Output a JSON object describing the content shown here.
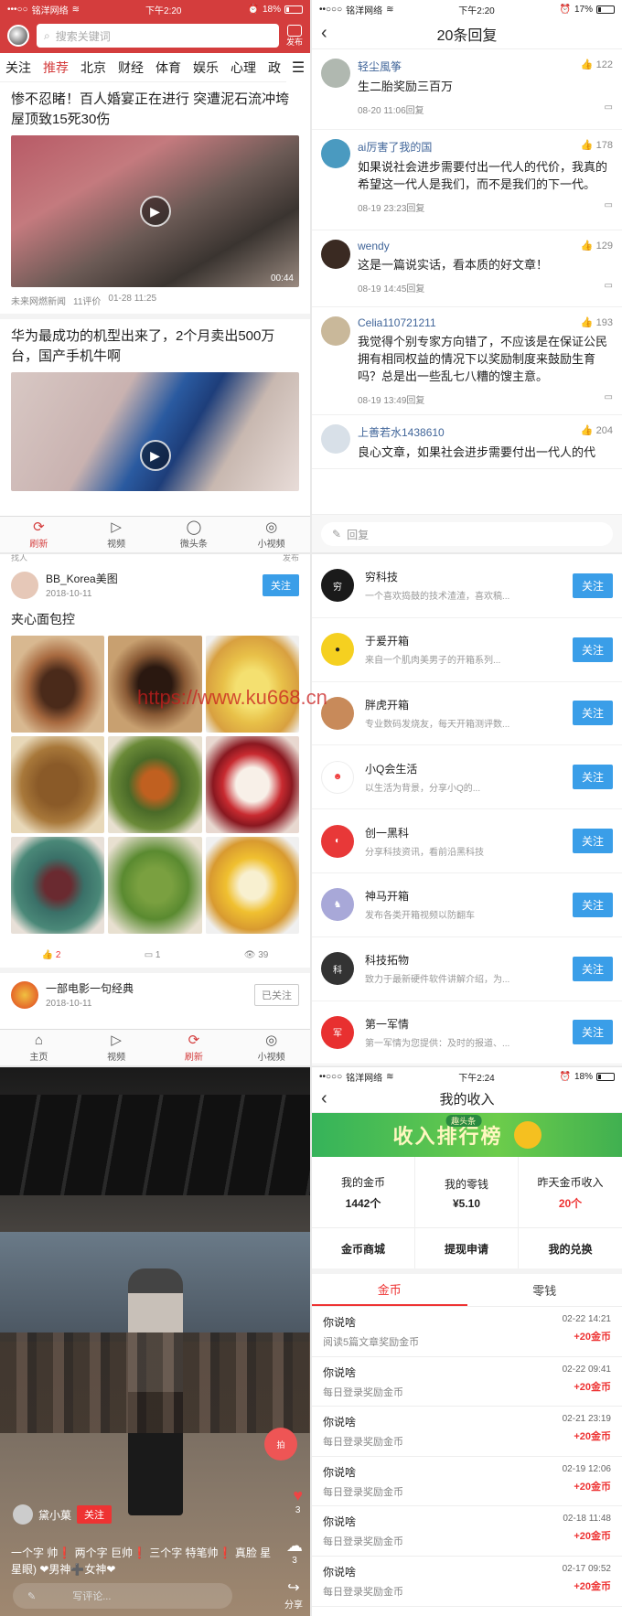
{
  "status1": {
    "carrier": "铭洋网络",
    "time": "下午2:20",
    "battery": "18%"
  },
  "status2": {
    "carrier": "铭洋网络",
    "time": "下午2:20",
    "battery": "17%"
  },
  "status6": {
    "carrier": "铭洋网络",
    "time": "下午2:24",
    "battery": "18%"
  },
  "feed": {
    "search_placeholder": "搜索关键词",
    "publish": "发布",
    "tabs": [
      "关注",
      "推荐",
      "北京",
      "财经",
      "体育",
      "娱乐",
      "心理",
      "政"
    ],
    "articles": [
      {
        "title": "惨不忍睹！百人婚宴正在进行 突遭泥石流冲垮屋顶致15死30伤",
        "duration": "00:44",
        "source": "未来网燃新闻",
        "comments": "11评价",
        "time": "01-28 11:25"
      },
      {
        "title": "华为最成功的机型出来了，2个月卖出500万台，国产手机牛啊"
      }
    ],
    "nav": [
      "刷新",
      "视频",
      "微头条",
      "小视频"
    ]
  },
  "replies": {
    "title": "20条回复",
    "items": [
      {
        "name": "轻尘風筝",
        "likes": "122",
        "text": "生二胎奖励三百万",
        "time": "08-20 11:06回复"
      },
      {
        "name": "ai厉害了我的国",
        "likes": "178",
        "text": "如果说社会进步需要付出一代人的代价，我真的希望这一代人是我们，而不是我们的下一代。",
        "time": "08-19 23:23回复"
      },
      {
        "name": "wendy",
        "likes": "129",
        "text": "这是一篇说实话，看本质的好文章！",
        "time": "08-19 14:45回复"
      },
      {
        "name": "Celia110721211",
        "likes": "193",
        "text": "我觉得个别专家方向错了，不应该是在保证公民拥有相同权益的情况下以奖励制度来鼓励生育吗？总是出一些乱七八糟的馊主意。",
        "time": "08-19 13:49回复"
      },
      {
        "name": "上善若水1438610",
        "likes": "204",
        "text": "良心文章，如果社会进步需要付出一代人的代"
      }
    ],
    "reply_placeholder": "回复"
  },
  "post": {
    "top_left": "找人",
    "top_right": "发布",
    "user": "BB_Korea美图",
    "date": "2018-10-11",
    "follow": "关注",
    "title": "夹心面包控",
    "likes": "2",
    "comments": "1",
    "views": "39",
    "next_user": "一部电影一句经典",
    "next_date": "2018-10-11",
    "followed": "已关注",
    "nav": [
      "主页",
      "视频",
      "刷新",
      "小视频"
    ],
    "watermark": "https://www.ku668.cn"
  },
  "follow_list": [
    {
      "name": "穷科技",
      "desc": "一个喜欢捣鼓的技术渣渣，喜欢稿..."
    },
    {
      "name": "于爰开箱",
      "desc": "来自一个肌肉美男子的开箱系列..."
    },
    {
      "name": "胖虎开箱",
      "desc": "专业数码发烧友，每天开箱测评数..."
    },
    {
      "name": "小Q会生活",
      "desc": "以生活为背景，分享小Q的..."
    },
    {
      "name": "创一黑科",
      "desc": "分享科技资讯，看前沿黑科技"
    },
    {
      "name": "神马开箱",
      "desc": "发布各类开箱视频以防翻车"
    },
    {
      "name": "科技拓物",
      "desc": "致力于最新硬件软件讲解介绍，为..."
    },
    {
      "name": "第一军情",
      "desc": "第一军情为您提供：及时的报道、..."
    }
  ],
  "follow_label": "关注",
  "video": {
    "user": "黛小菓",
    "follow": "关注",
    "caption": "一个字 帅❗ 两个字 巨帅❗ 三个字 特笔帅❗ 真脸 星星眼) ❤男神➕女神❤",
    "likes": "3",
    "comments": "3",
    "comment_placeholder": "写评论...",
    "share": "分享",
    "record": "拍"
  },
  "income": {
    "title": "我的收入",
    "banner_small": "趣头条",
    "banner_big": "收入排行榜",
    "stats": [
      {
        "label": "我的金币",
        "value": "1442个"
      },
      {
        "label": "我的零钱",
        "value": "¥5.10"
      },
      {
        "label": "昨天金币收入",
        "value": "20个"
      }
    ],
    "actions": [
      "金币商城",
      "提现申请",
      "我的兑换"
    ],
    "tabs": [
      "金币",
      "零钱"
    ],
    "records": [
      {
        "title": "你说啥",
        "desc": "阅读5篇文章奖励金币",
        "time": "02-22 14:21",
        "amount": "+20金币"
      },
      {
        "title": "你说啥",
        "desc": "每日登录奖励金币",
        "time": "02-22 09:41",
        "amount": "+20金币"
      },
      {
        "title": "你说啥",
        "desc": "每日登录奖励金币",
        "time": "02-21 23:19",
        "amount": "+20金币"
      },
      {
        "title": "你说啥",
        "desc": "每日登录奖励金币",
        "time": "02-19 12:06",
        "amount": "+20金币"
      },
      {
        "title": "你说啥",
        "desc": "每日登录奖励金币",
        "time": "02-18 11:48",
        "amount": "+20金币"
      },
      {
        "title": "你说啥",
        "desc": "每日登录奖励金币",
        "time": "02-17 09:52",
        "amount": "+20金币"
      }
    ]
  }
}
